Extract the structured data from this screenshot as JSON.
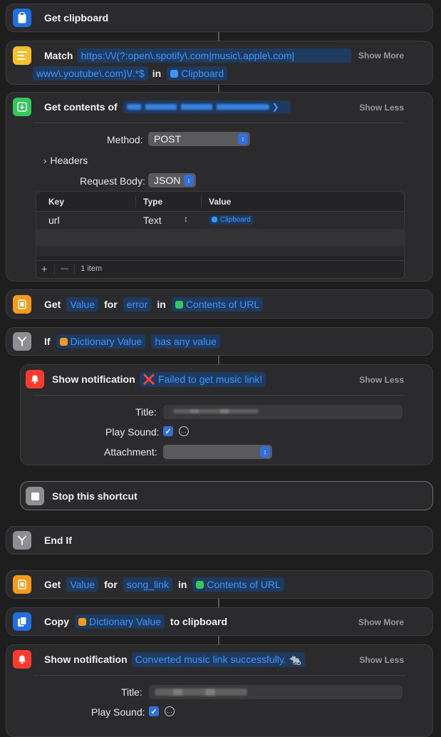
{
  "actions": {
    "get_clipboard": {
      "title": "Get clipboard"
    },
    "match": {
      "title": "Match",
      "pattern_line1": "https:\\/\\/(?:open\\.spotify\\.com|music\\.apple\\.com|",
      "pattern_line2": "www\\.youtube\\.com)\\/.*$",
      "in_label": "in",
      "source": "Clipboard",
      "toggle": "Show More"
    },
    "get_contents": {
      "title": "Get contents of",
      "toggle": "Show Less",
      "method_label": "Method:",
      "method_value": "POST",
      "headers_label": "Headers",
      "body_label": "Request Body:",
      "body_value": "JSON",
      "table": {
        "columns": [
          "Key",
          "Type",
          "Value"
        ],
        "rows": [
          {
            "key": "url",
            "type": "Text",
            "value": "Clipboard"
          }
        ],
        "add": "+",
        "remove": "—",
        "count": "1 item"
      }
    },
    "get_value_error": {
      "get": "Get",
      "key_type": "Value",
      "for": "for",
      "key": "error",
      "in": "in",
      "source": "Contents of URL"
    },
    "if": {
      "title": "If",
      "input": "Dictionary Value",
      "condition": "has any value"
    },
    "notify_fail": {
      "title": "Show notification",
      "message": "❌ Failed to get music link!",
      "toggle": "Show Less",
      "title_label": "Title:",
      "sound_label": "Play Sound:",
      "attach_label": "Attachment:"
    },
    "stop": {
      "title": "Stop this shortcut"
    },
    "end_if": {
      "title": "End If"
    },
    "get_value_song": {
      "get": "Get",
      "key_type": "Value",
      "for": "for",
      "key": "song_link",
      "in": "in",
      "source": "Contents of URL"
    },
    "copy": {
      "title": "Copy",
      "input": "Dictionary Value",
      "suffix": "to clipboard",
      "toggle": "Show More"
    },
    "notify_ok": {
      "title": "Show notification",
      "message": "Converted music link successfully. 🐀",
      "toggle": "Show Less",
      "title_label": "Title:",
      "sound_label": "Play Sound:"
    }
  },
  "colors": {
    "background": "#1e1e1e",
    "card": "#2b2b2d",
    "accent": "#3d96ff",
    "token_bg": "#1f3a5f",
    "icon_blue": "#1f6fe0",
    "icon_yellow": "#f5c02a",
    "icon_green": "#34c759",
    "icon_orange": "#f59a1a",
    "icon_gray": "#8e8e93",
    "icon_red": "#ff3b30"
  },
  "icons": [
    "clipboard-icon",
    "text-lines-icon",
    "download-icon",
    "dictionary-icon",
    "branch-icon",
    "bell-icon",
    "stop-icon",
    "copy-icon"
  ]
}
